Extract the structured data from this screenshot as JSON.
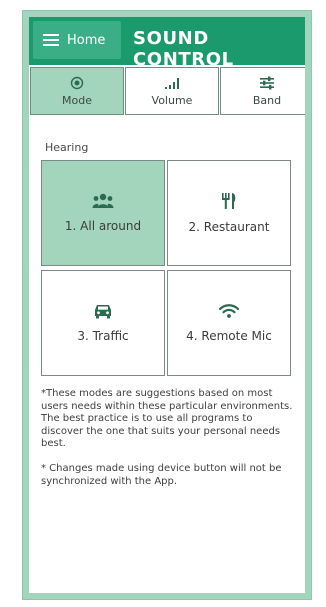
{
  "header": {
    "home_label": "Home",
    "title": "SOUND CONTROL"
  },
  "tabs": [
    {
      "label": "Mode",
      "icon": "target-icon",
      "active": true
    },
    {
      "label": "Volume",
      "icon": "signal-bars-icon",
      "active": false
    },
    {
      "label": "Band",
      "icon": "sliders-icon",
      "active": false
    }
  ],
  "section_label": "Hearing",
  "modes": [
    {
      "label": "1. All around",
      "icon": "group-icon",
      "active": true
    },
    {
      "label": "2. Restaurant",
      "icon": "utensils-icon",
      "active": false
    },
    {
      "label": "3. Traffic",
      "icon": "car-icon",
      "active": false
    },
    {
      "label": "4. Remote Mic",
      "icon": "wifi-icon",
      "active": false
    }
  ],
  "notes": {
    "suggestion": "*These modes are suggestions based on most users needs within these particular environments. The best practice is to use all programs to discover the one that suits your personal needs best.",
    "sync": "* Changes made using device button will not be synchronized with the App."
  },
  "colors": {
    "header_bg": "#1b9a6e",
    "accent_light": "#a3d5bd",
    "icon_dark": "#2b6b50"
  }
}
